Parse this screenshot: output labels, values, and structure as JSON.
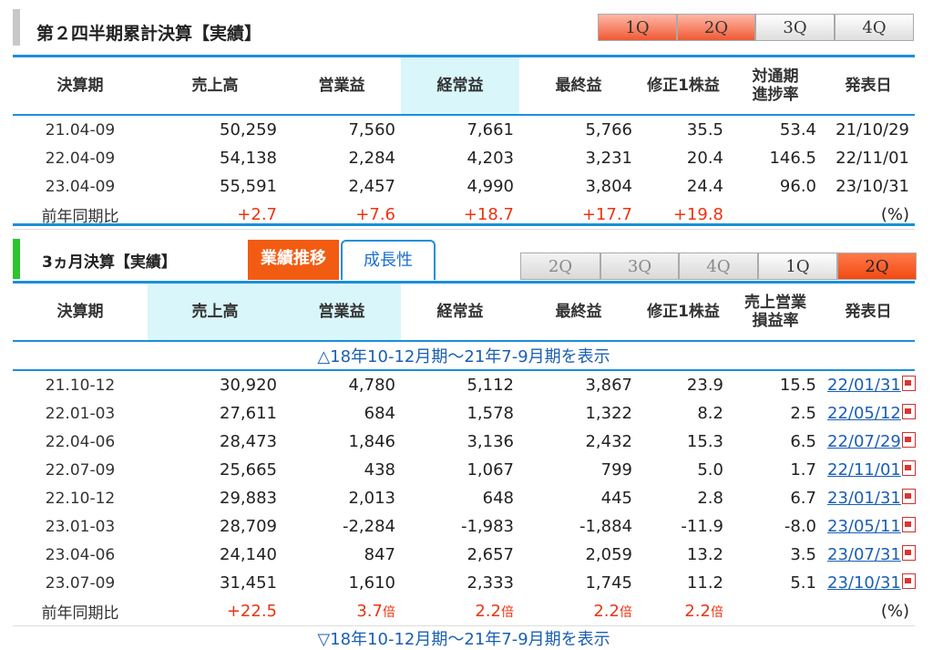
{
  "section1": {
    "title": "第２四半期累計決算【実績】",
    "quarter_buttons": [
      "1Q",
      "2Q",
      "3Q",
      "4Q"
    ],
    "headers": [
      "決算期",
      "売上高",
      "営業益",
      "経常益",
      "最終益",
      "修正1株益",
      "対通期\n進捗率",
      "発表日"
    ],
    "rows": [
      [
        "21.04-09",
        "50,259",
        "7,560",
        "7,661",
        "5,766",
        "35.5",
        "53.4",
        "21/10/29"
      ],
      [
        "22.04-09",
        "54,138",
        "2,284",
        "4,203",
        "3,231",
        "20.4",
        "146.5",
        "22/11/01"
      ],
      [
        "23.04-09",
        "55,591",
        "2,457",
        "4,990",
        "3,804",
        "24.4",
        "96.0",
        "23/10/31"
      ]
    ],
    "yoy": {
      "label": "前年同期比",
      "values": [
        "+2.7",
        "+7.6",
        "+18.7",
        "+17.7",
        "+19.8"
      ],
      "unit": "(%)"
    }
  },
  "section2": {
    "title": "3ヵ月決算【実績】",
    "tabs": [
      "業績推移",
      "成長性"
    ],
    "quarter_buttons": [
      "2Q",
      "3Q",
      "4Q",
      "1Q",
      "2Q"
    ],
    "headers": [
      "決算期",
      "売上高",
      "営業益",
      "経常益",
      "最終益",
      "修正1株益",
      "売上営業\n損益率",
      "発表日"
    ],
    "show_earlier": "△18年10-12月期～21年7-9月期を表示",
    "rows": [
      [
        "21.10-12",
        "30,920",
        "4,780",
        "5,112",
        "3,867",
        "23.9",
        "15.5",
        "22/01/31"
      ],
      [
        "22.01-03",
        "27,611",
        "684",
        "1,578",
        "1,322",
        "8.2",
        "2.5",
        "22/05/12"
      ],
      [
        "22.04-06",
        "28,473",
        "1,846",
        "3,136",
        "2,432",
        "15.3",
        "6.5",
        "22/07/29"
      ],
      [
        "22.07-09",
        "25,665",
        "438",
        "1,067",
        "799",
        "5.0",
        "1.7",
        "22/11/01"
      ],
      [
        "22.10-12",
        "29,883",
        "2,013",
        "648",
        "445",
        "2.8",
        "6.7",
        "23/01/31"
      ],
      [
        "23.01-03",
        "28,709",
        "-2,284",
        "-1,983",
        "-1,884",
        "-11.9",
        "-8.0",
        "23/05/11"
      ],
      [
        "23.04-06",
        "24,140",
        "847",
        "2,657",
        "2,059",
        "13.2",
        "3.5",
        "23/07/31"
      ],
      [
        "23.07-09",
        "31,451",
        "1,610",
        "2,333",
        "1,745",
        "11.2",
        "5.1",
        "23/10/31"
      ]
    ],
    "yoy": {
      "label": "前年同期比",
      "values": [
        "+22.5",
        "3.7",
        "2.2",
        "2.2",
        "2.2"
      ],
      "times": "倍",
      "unit": "(%)"
    },
    "show_later": "▽18年10-12月期～21年7-9月期を表示"
  }
}
